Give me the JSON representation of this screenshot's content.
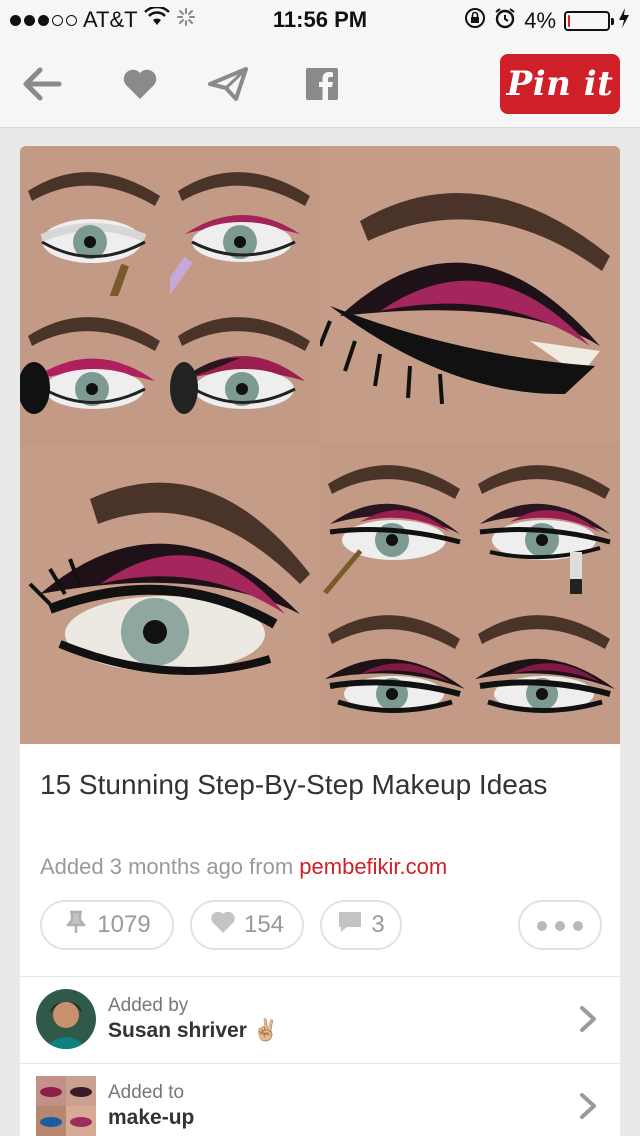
{
  "status_bar": {
    "carrier": "AT&T",
    "time": "11:56 PM",
    "battery": "4%",
    "battery_level": 0.04,
    "icons": [
      "wifi-icon",
      "activity-spinner-icon",
      "rotation-lock-icon",
      "alarm-icon",
      "battery-icon",
      "charging-icon"
    ]
  },
  "toolbar": {
    "icons": [
      "back-arrow-icon",
      "heart-icon",
      "send-icon",
      "facebook-icon"
    ],
    "pin_label": "Pin it",
    "brand_color": "#cf1f28"
  },
  "pin": {
    "title": "15 Stunning Step-By-Step Makeup Ideas",
    "added_prefix": "Added 3 months ago from",
    "source": "pembefikir.com",
    "stats": {
      "repins": "1079",
      "likes": "154",
      "comments": "3"
    }
  },
  "added_by": {
    "label": "Added by",
    "name": "Susan shriver ✌🏼"
  },
  "added_to": {
    "label": "Added to",
    "board": "make-up"
  }
}
